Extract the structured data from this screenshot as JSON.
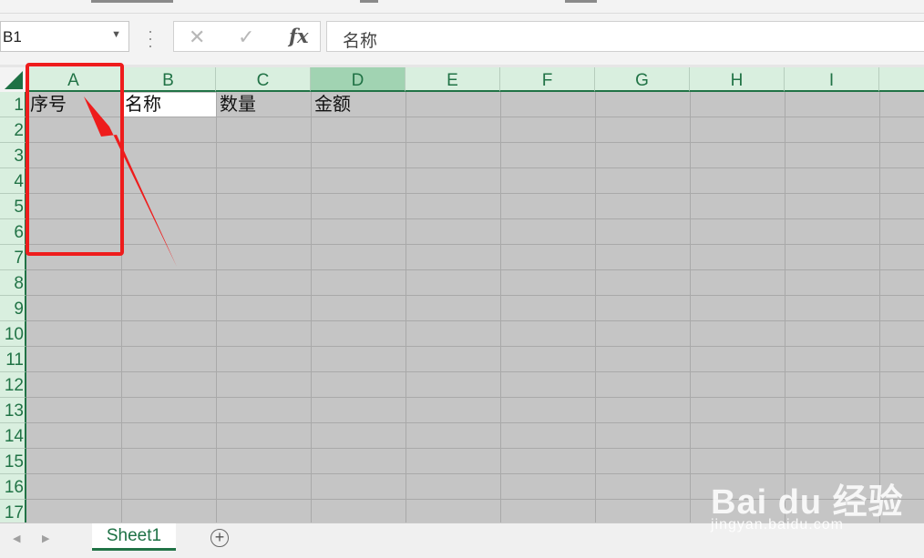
{
  "name_box": {
    "value": "B1"
  },
  "formula_bar": {
    "cancel_glyph": "✕",
    "enter_glyph": "✓",
    "fx_label": "fx",
    "value": "名称"
  },
  "columns": [
    "A",
    "B",
    "C",
    "D",
    "E",
    "F",
    "G",
    "H",
    "I"
  ],
  "selected_column": "D",
  "rows": [
    "1",
    "2",
    "3",
    "4",
    "5",
    "6",
    "7",
    "8",
    "9",
    "10",
    "11",
    "12",
    "13",
    "14",
    "15",
    "16",
    "17"
  ],
  "cells": {
    "A1": "序号",
    "B1": "名称",
    "C1": "数量",
    "D1": "金额"
  },
  "active_cell": "B1",
  "sheet_tabs": [
    "Sheet1"
  ],
  "add_sheet_label": "+",
  "watermark": {
    "logo": "Bai du 经验",
    "url": "jingyan.baidu.com"
  },
  "colors": {
    "accent": "#217346",
    "header_bg": "#d9efdf",
    "annotation": "#ee1c1c",
    "grid_bg": "#c5c5c5"
  }
}
